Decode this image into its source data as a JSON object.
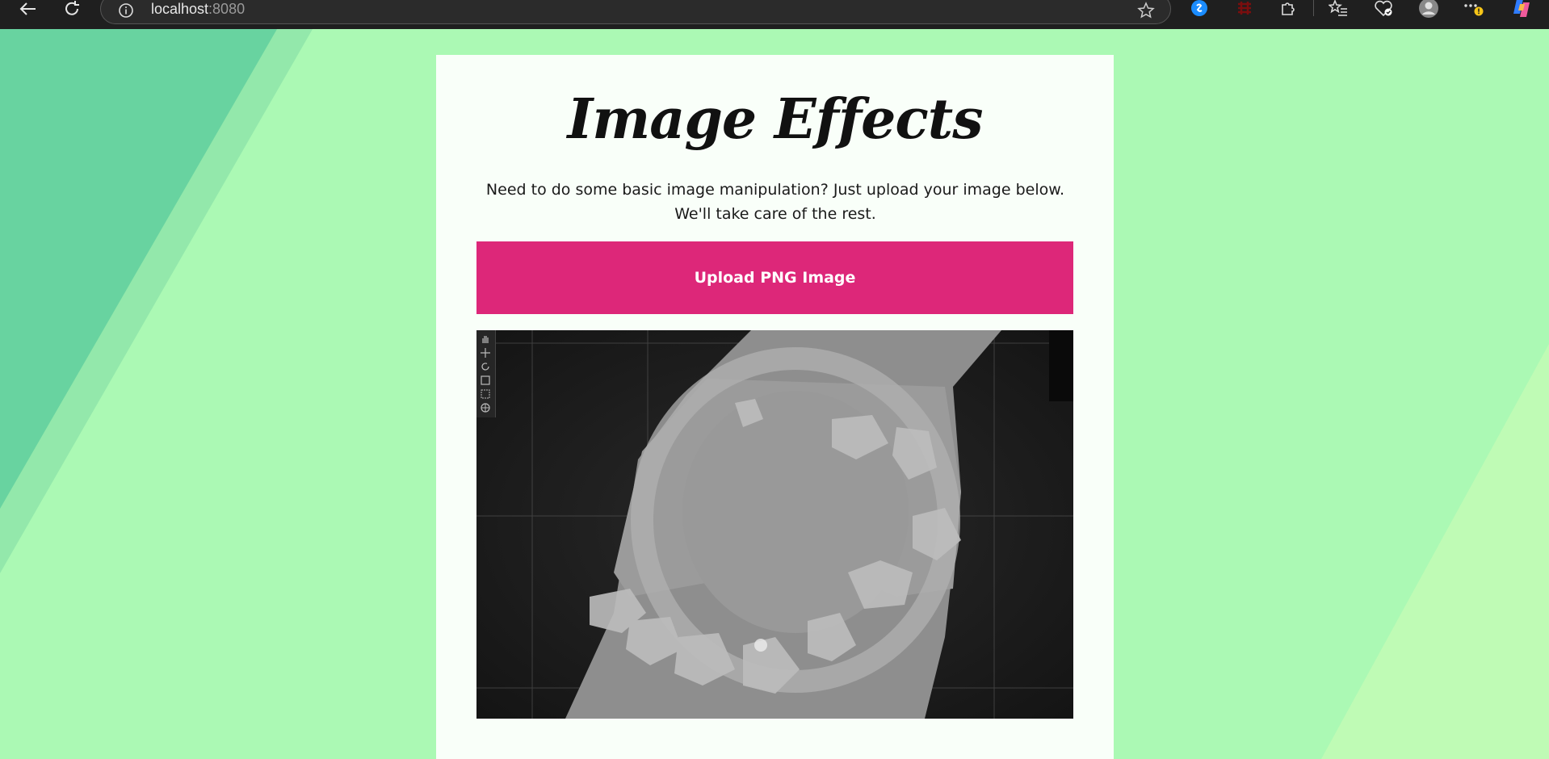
{
  "browser": {
    "url_host": "localhost",
    "url_port": ":8080"
  },
  "page": {
    "title": "Image Effects",
    "description": "Need to do some basic image manipulation? Just upload your image below. We'll take care of the rest.",
    "upload_label": "Upload PNG Image"
  },
  "colors": {
    "background": "#abf9b4",
    "accent": "#dd2779",
    "card": "#f9fff9"
  }
}
